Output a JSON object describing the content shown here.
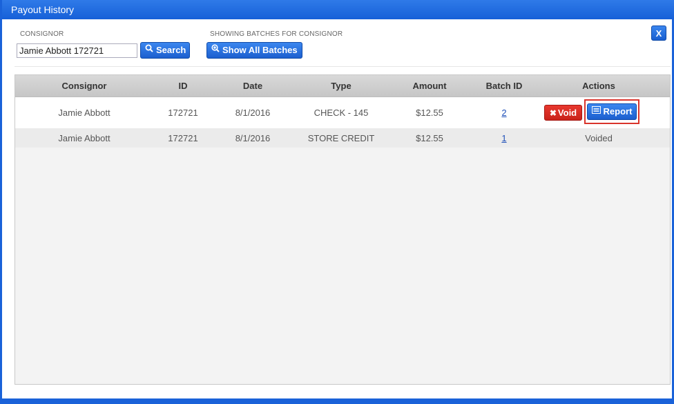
{
  "window": {
    "title": "Payout History",
    "close_label": "X"
  },
  "filters": {
    "consignor_label": "CONSIGNOR",
    "consignor_value": "Jamie Abbott 172721",
    "search_label": "Search",
    "showing_label": "SHOWING BATCHES FOR CONSIGNOR",
    "show_all_label": "Show All Batches"
  },
  "table": {
    "columns": [
      "Consignor",
      "ID",
      "Date",
      "Type",
      "Amount",
      "Batch ID",
      "Actions"
    ],
    "rows": [
      {
        "consignor": "Jamie Abbott",
        "id": "172721",
        "date": "8/1/2016",
        "type": "CHECK - 145",
        "amount": "$12.55",
        "batch_id": "2",
        "void_label": "Void",
        "report_label": "Report"
      },
      {
        "consignor": "Jamie Abbott",
        "id": "172721",
        "date": "8/1/2016",
        "type": "STORE CREDIT",
        "amount": "$12.55",
        "batch_id": "1",
        "status": "Voided"
      }
    ]
  },
  "colors": {
    "title_bar": "#1a62d9",
    "primary_button": "#2a72e0",
    "danger_button": "#d72b22",
    "highlight_outline": "#d9342b"
  },
  "icons": {
    "search": "magnifier",
    "show_all": "zoom-in-magnifier",
    "void": "x-mark",
    "report": "list-card"
  }
}
